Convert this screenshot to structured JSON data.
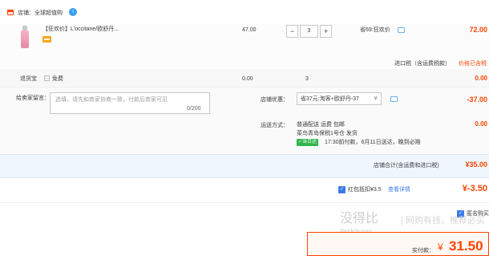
{
  "store": {
    "label": "店铺：全球超值购",
    "badge": "i"
  },
  "item": {
    "title": "【狂欢价】L'occitane/欧舒丹...",
    "price": "47.00",
    "quantity": "3",
    "minus": "−",
    "plus": "+",
    "saving": "省69:狂欢价",
    "subtotal": "72.00",
    "tax_note": "进口税（含运费税款）",
    "tax_link": "价格已含税"
  },
  "insurance": {
    "label": "退货宝",
    "free": "免费",
    "price": "0.00",
    "quantity": "3",
    "subtotal": "0.00"
  },
  "message": {
    "label": "给卖家留言：",
    "placeholder": "选填，请先和商家协商一致，付款后商家可见",
    "count": "0/200"
  },
  "promo": {
    "label": "店铺优惠：",
    "selected": "省37元:淘客+欧舒丹-37",
    "amount": "-37.00"
  },
  "shipping": {
    "label": "运送方式：",
    "line1": "普通配送 运费 包邮",
    "line2": "菜鸟青岛保税1号仓  发货",
    "tag": "✓当日达",
    "line3": "17:30前付款，6月11日送达，晚到必赔",
    "amount": "0.00"
  },
  "store_total": {
    "label": "店铺合计(含运费和进口税)",
    "amount": "¥35.00"
  },
  "red_packet": {
    "label": "红包抵扣¥3.5",
    "link": "查看详情",
    "amount": "¥-3.50"
  },
  "anonymous": {
    "label": "匿名购买"
  },
  "payment": {
    "label": "实付款：",
    "symbol": "¥",
    "amount": "31.50"
  },
  "watermark": {
    "main": "没得比",
    "sub": "Meidebi.com",
    "side": "| 网购有钱，推荐必买"
  },
  "colors": {
    "accent": "#ff4400",
    "blue": "#3b7be9",
    "green": "#31b54c"
  }
}
